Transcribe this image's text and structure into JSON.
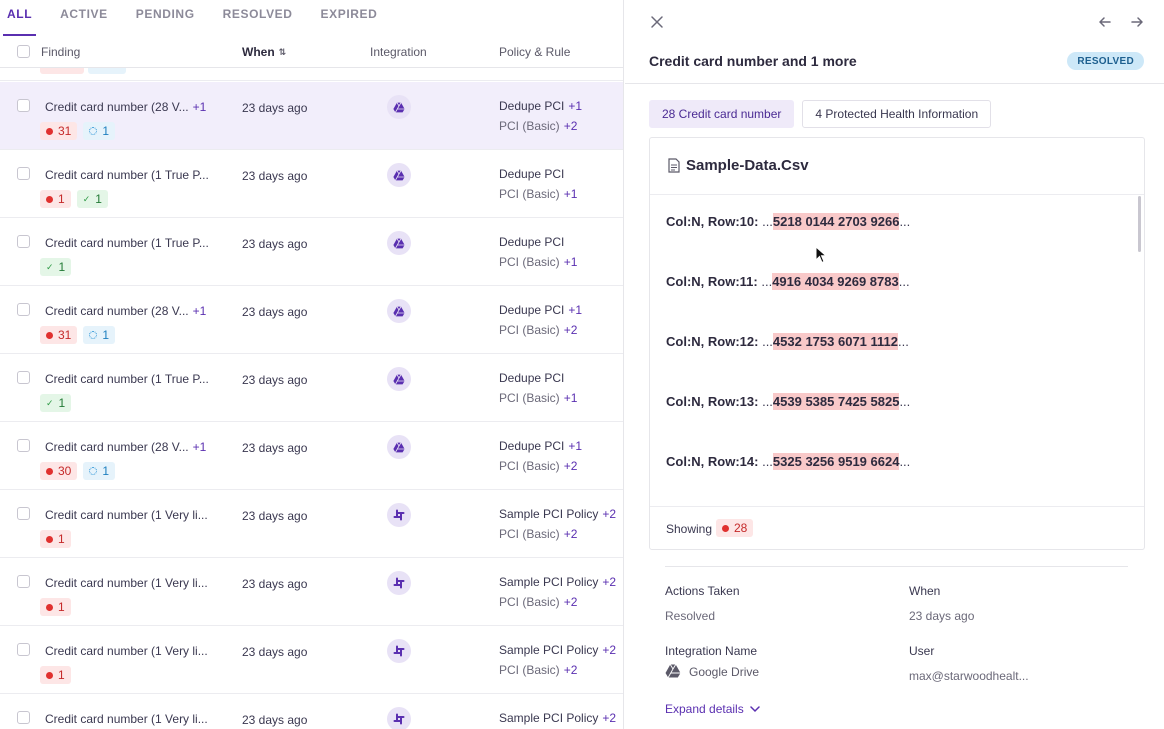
{
  "tabs": [
    "ALL",
    "ACTIVE",
    "PENDING",
    "RESOLVED",
    "EXPIRED"
  ],
  "active_tab": "ALL",
  "table": {
    "headers": {
      "finding": "Finding",
      "when": "When",
      "integration": "Integration",
      "policy": "Policy & Rule"
    },
    "rows": [
      {
        "finding": "Credit card number (28 V...",
        "finding_more": "+1",
        "badges": [
          {
            "type": "red",
            "value": "31"
          },
          {
            "type": "blue",
            "value": "1"
          }
        ],
        "when": "23 days ago",
        "integration_icon": "google-drive-icon",
        "policy": "Dedupe PCI",
        "policy_more": "+1",
        "rule": "PCI (Basic)",
        "rule_more": "+2",
        "selected": true
      },
      {
        "finding": "Credit card number (1 True P...",
        "finding_more": "",
        "badges": [
          {
            "type": "red",
            "value": "1"
          },
          {
            "type": "green",
            "value": "1"
          }
        ],
        "when": "23 days ago",
        "integration_icon": "google-drive-icon",
        "policy": "Dedupe PCI",
        "policy_more": "",
        "rule": "PCI (Basic)",
        "rule_more": "+1",
        "selected": false
      },
      {
        "finding": "Credit card number (1 True P...",
        "finding_more": "",
        "badges": [
          {
            "type": "green",
            "value": "1"
          }
        ],
        "when": "23 days ago",
        "integration_icon": "google-drive-icon",
        "policy": "Dedupe PCI",
        "policy_more": "",
        "rule": "PCI (Basic)",
        "rule_more": "+1",
        "selected": false
      },
      {
        "finding": "Credit card number (28 V...",
        "finding_more": "+1",
        "badges": [
          {
            "type": "red",
            "value": "31"
          },
          {
            "type": "blue",
            "value": "1"
          }
        ],
        "when": "23 days ago",
        "integration_icon": "google-drive-icon",
        "policy": "Dedupe PCI",
        "policy_more": "+1",
        "rule": "PCI (Basic)",
        "rule_more": "+2",
        "selected": false
      },
      {
        "finding": "Credit card number (1 True P...",
        "finding_more": "",
        "badges": [
          {
            "type": "green",
            "value": "1"
          }
        ],
        "when": "23 days ago",
        "integration_icon": "google-drive-icon",
        "policy": "Dedupe PCI",
        "policy_more": "",
        "rule": "PCI (Basic)",
        "rule_more": "+1",
        "selected": false
      },
      {
        "finding": "Credit card number (28 V...",
        "finding_more": "+1",
        "badges": [
          {
            "type": "red",
            "value": "30"
          },
          {
            "type": "blue",
            "value": "1"
          }
        ],
        "when": "23 days ago",
        "integration_icon": "google-drive-icon",
        "policy": "Dedupe PCI",
        "policy_more": "+1",
        "rule": "PCI (Basic)",
        "rule_more": "+2",
        "selected": false
      },
      {
        "finding": "Credit card number (1 Very li...",
        "finding_more": "",
        "badges": [
          {
            "type": "red",
            "value": "1"
          }
        ],
        "when": "23 days ago",
        "integration_icon": "slack-icon",
        "policy": "Sample PCI Policy",
        "policy_more": "+2",
        "rule": "PCI (Basic)",
        "rule_more": "+2",
        "selected": false
      },
      {
        "finding": "Credit card number (1 Very li...",
        "finding_more": "",
        "badges": [
          {
            "type": "red",
            "value": "1"
          }
        ],
        "when": "23 days ago",
        "integration_icon": "slack-icon",
        "policy": "Sample PCI Policy",
        "policy_more": "+2",
        "rule": "PCI (Basic)",
        "rule_more": "+2",
        "selected": false
      },
      {
        "finding": "Credit card number (1 Very li...",
        "finding_more": "",
        "badges": [
          {
            "type": "red",
            "value": "1"
          }
        ],
        "when": "23 days ago",
        "integration_icon": "slack-icon",
        "policy": "Sample PCI Policy",
        "policy_more": "+2",
        "rule": "PCI (Basic)",
        "rule_more": "+2",
        "selected": false
      },
      {
        "finding": "Credit card number (1 Very li...",
        "finding_more": "",
        "badges": [],
        "when": "23 days ago",
        "integration_icon": "slack-icon",
        "policy": "Sample PCI Policy",
        "policy_more": "+2",
        "rule": "",
        "rule_more": "",
        "selected": false
      }
    ]
  },
  "detail": {
    "title": "Credit card number and 1 more",
    "status": "RESOLVED",
    "category_tabs": [
      "28 Credit card number",
      "4 Protected Health Information"
    ],
    "file_name": "Sample-Data.Csv",
    "matches": [
      {
        "location": "Col:N, Row:10:",
        "prefix": "...",
        "value": "5218 0144 2703 9266",
        "suffix": "..."
      },
      {
        "location": "Col:N, Row:11:",
        "prefix": "...",
        "value": "4916 4034 9269 8783",
        "suffix": "..."
      },
      {
        "location": "Col:N, Row:12:",
        "prefix": "...",
        "value": "4532 1753 6071 1112",
        "suffix": "..."
      },
      {
        "location": "Col:N, Row:13:",
        "prefix": "...",
        "value": "4539 5385 7425 5825",
        "suffix": "..."
      },
      {
        "location": "Col:N, Row:14:",
        "prefix": "...",
        "value": "5325 3256 9519 6624",
        "suffix": "..."
      }
    ],
    "showing_label": "Showing",
    "showing_count": "28",
    "actions_taken_label": "Actions Taken",
    "actions_taken_value": "Resolved",
    "when_label": "When",
    "when_value": "23 days ago",
    "integration_label": "Integration Name",
    "integration_value": "Google Drive",
    "user_label": "User",
    "user_value": "max@starwoodhealt...",
    "expand_label": "Expand details"
  },
  "colors": {
    "accent": "#5a2fb0",
    "danger": "#e0312f",
    "info": "#2b94d6",
    "success": "#2e9a45",
    "selected_row": "#f2eefb"
  }
}
